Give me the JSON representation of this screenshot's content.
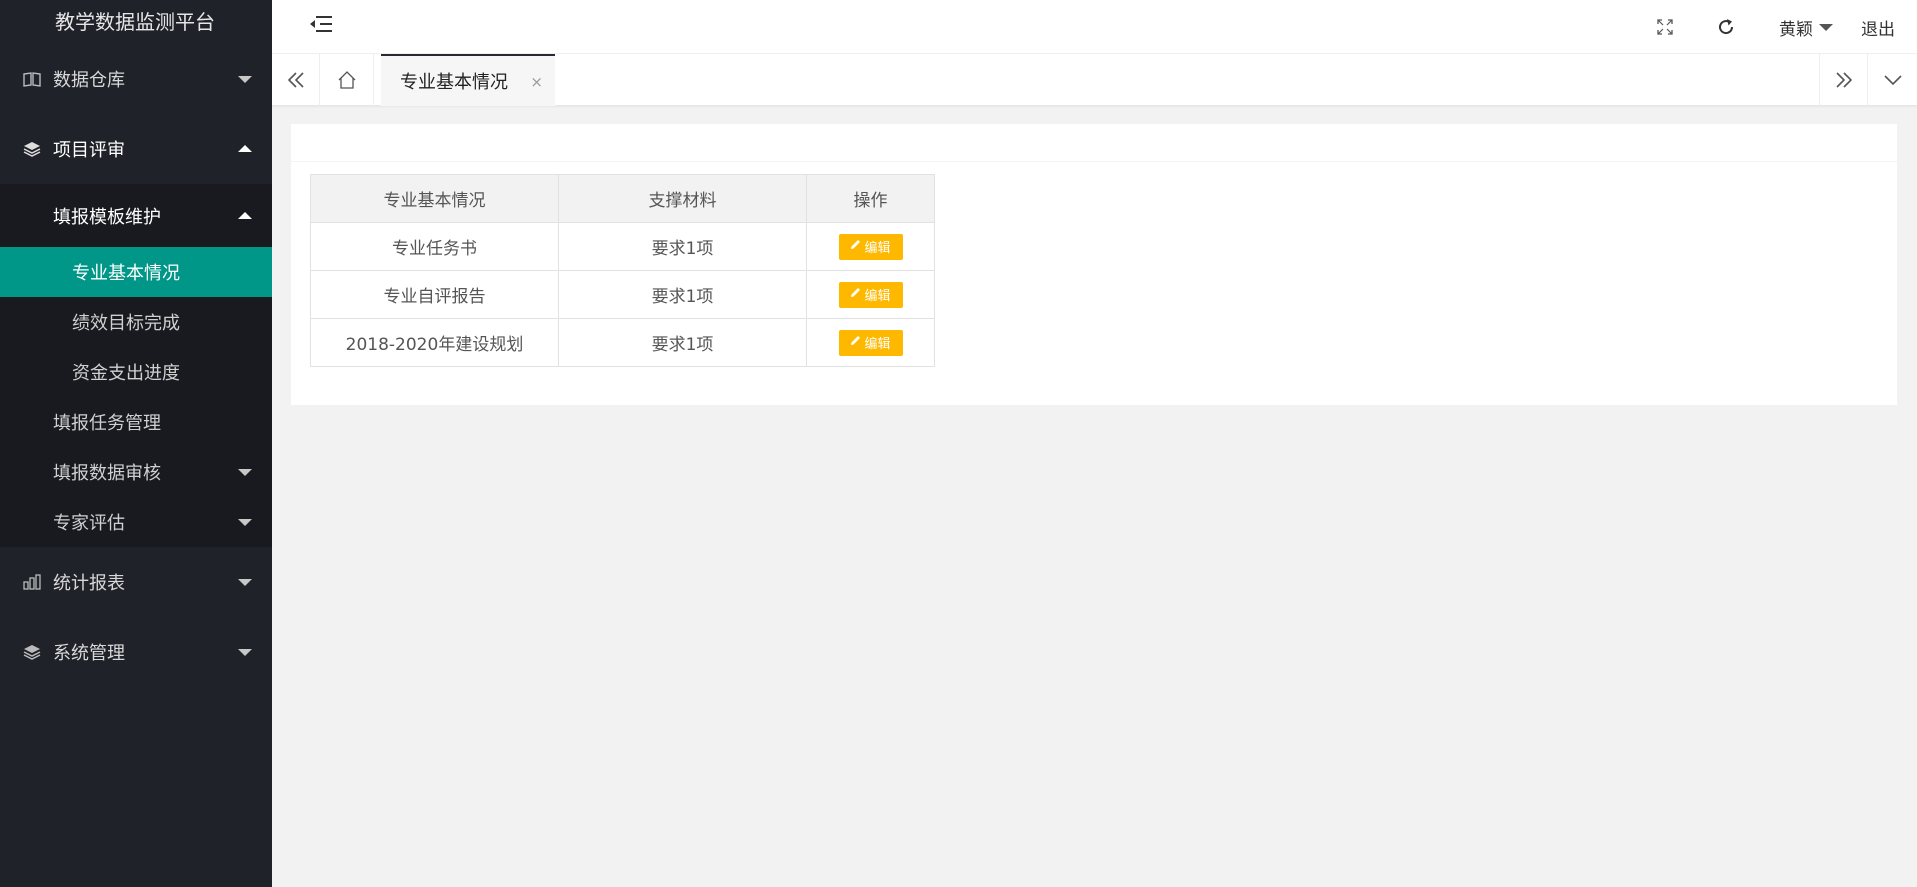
{
  "app": {
    "title": "教学数据监测平台"
  },
  "sidebar": {
    "items": [
      {
        "label": "数据仓库",
        "icon": "book-icon"
      },
      {
        "label": "项目评审",
        "icon": "layers-icon"
      },
      {
        "label": "统计报表",
        "icon": "bar-chart-icon"
      },
      {
        "label": "系统管理",
        "icon": "layers-icon"
      }
    ],
    "sub": {
      "template": "填报模板维护",
      "leaves": [
        "专业基本情况",
        "绩效目标完成",
        "资金支出进度"
      ],
      "task": "填报任务管理",
      "audit": "填报数据审核",
      "expert": "专家评估"
    }
  },
  "header": {
    "user": "黄颖",
    "logout": "退出"
  },
  "tabs": {
    "current": "专业基本情况",
    "close": "×"
  },
  "table": {
    "headers": [
      "专业基本情况",
      "支撑材料",
      "操作"
    ],
    "rows": [
      {
        "name": "专业任务书",
        "req": "要求1项",
        "action": "编辑"
      },
      {
        "name": "专业自评报告",
        "req": "要求1项",
        "action": "编辑"
      },
      {
        "name": "2018-2020年建设规划",
        "req": "要求1项",
        "action": "编辑"
      }
    ]
  },
  "colors": {
    "sidebar": "#20222a",
    "accent": "#009688",
    "warn": "#ffb800"
  }
}
